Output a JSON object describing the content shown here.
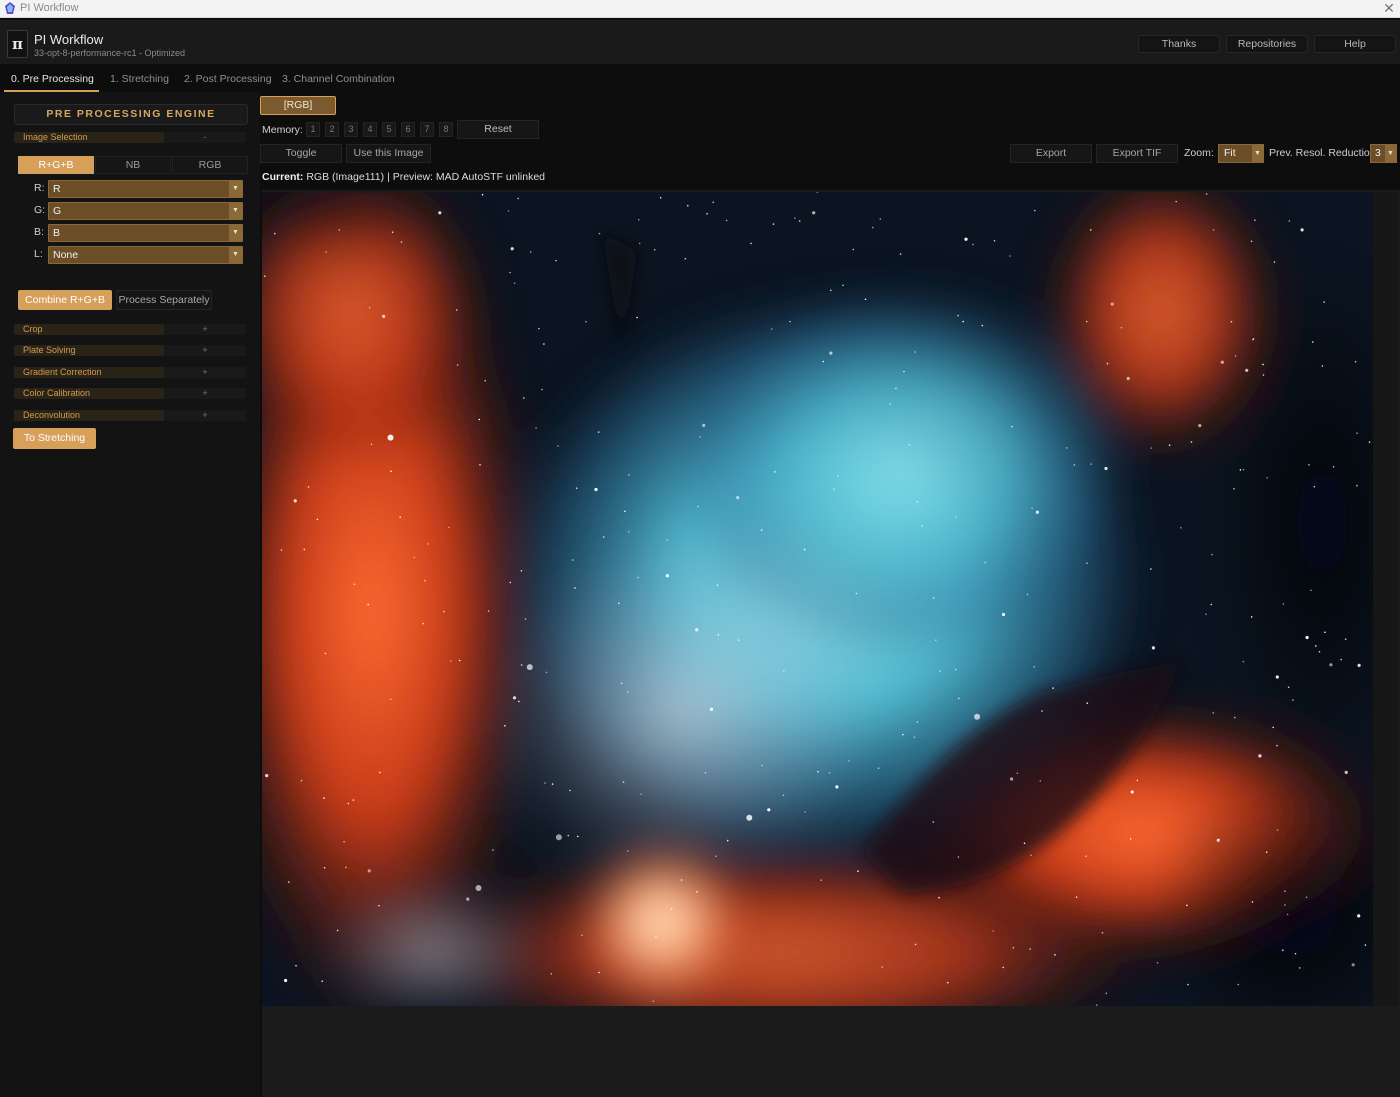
{
  "window": {
    "title": "PI Workflow",
    "close": "✕"
  },
  "header": {
    "logo": "π",
    "app_name": "PI Workflow",
    "version": "33-opt-8-performance-rc1 - Optimized",
    "buttons": {
      "thanks": "Thanks",
      "repositories": "Repositories",
      "help": "Help"
    }
  },
  "tabs": [
    {
      "label": "0. Pre Processing",
      "active": true
    },
    {
      "label": "1. Stretching",
      "active": false
    },
    {
      "label": "2. Post Processing",
      "active": false
    },
    {
      "label": "3. Channel Combination",
      "active": false
    }
  ],
  "sidebar": {
    "engine_title": "PRE PROCESSING ENGINE",
    "image_selection": {
      "label": "Image Selection",
      "toggle": "-"
    },
    "mode_tabs": [
      {
        "label": "R+G+B",
        "active": true
      },
      {
        "label": "NB",
        "active": false
      },
      {
        "label": "RGB",
        "active": false
      }
    ],
    "channels": [
      {
        "label": "R:",
        "value": "R"
      },
      {
        "label": "G:",
        "value": "G"
      },
      {
        "label": "B:",
        "value": "B"
      },
      {
        "label": "L:",
        "value": "None"
      }
    ],
    "combine_button": "Combine R+G+B",
    "separate_button": "Process Separately",
    "sections": [
      {
        "label": "Crop",
        "toggle": "+"
      },
      {
        "label": "Plate Solving",
        "toggle": "+"
      },
      {
        "label": "Gradient Correction",
        "toggle": "+"
      },
      {
        "label": "Color Calibration",
        "toggle": "+"
      },
      {
        "label": "Deconvolution",
        "toggle": "+"
      }
    ],
    "to_stretching": "To Stretching"
  },
  "toolbar": {
    "rgb_badge": "[RGB]",
    "memory_label": "Memory:",
    "memory_slots": [
      "1",
      "2",
      "3",
      "4",
      "5",
      "6",
      "7",
      "8"
    ],
    "reset": "Reset",
    "toggle": "Toggle",
    "use_image": "Use this Image",
    "export": "Export",
    "export_tif": "Export TIF",
    "zoom_label": "Zoom:",
    "zoom_value": "Fit",
    "prev_label": "Prev. Resol. Reduction",
    "prev_value": "3",
    "current_prefix": "Current:",
    "current_text": " RGB (Image111) | Preview: MAD AutoSTF unlinked"
  },
  "colors": {
    "accent": "#d6a05a",
    "select_bg": "#6b4e28",
    "section_text": "#d09b4f",
    "bg": "#0d0d0e"
  }
}
